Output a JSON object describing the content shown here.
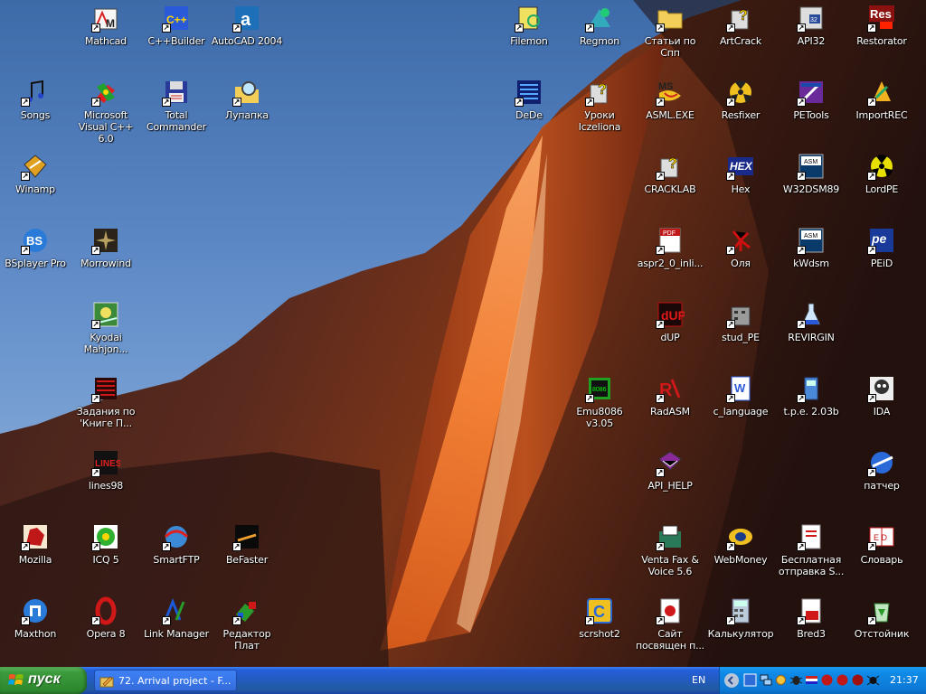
{
  "desktop": {
    "icons": [
      {
        "label": "Mathcad",
        "icon": "mathcad-icon"
      },
      {
        "label": "C++Builder",
        "icon": "cppbuilder-icon"
      },
      {
        "label": "AutoCAD 2004",
        "icon": "autocad-icon"
      },
      {
        "label": "Filemon",
        "icon": "filemon-icon"
      },
      {
        "label": "Regmon",
        "icon": "regmon-icon"
      },
      {
        "label": "Статьи по Спп",
        "icon": "folder-icon"
      },
      {
        "label": "ArtCrack",
        "icon": "help-icon"
      },
      {
        "label": "API32",
        "icon": "api32-icon"
      },
      {
        "label": "Restorator",
        "icon": "restorator-icon"
      },
      {
        "label": "Songs",
        "icon": "music-note-icon"
      },
      {
        "label": "Microsoft Visual C++ 6.0",
        "icon": "msvc-icon"
      },
      {
        "label": "Total Commander",
        "icon": "floppy-icon"
      },
      {
        "label": "Лупапка",
        "icon": "magnifier-folder-icon"
      },
      {
        "label": "DeDe",
        "icon": "dede-icon"
      },
      {
        "label": "Уроки Iczeliona",
        "icon": "help-icon"
      },
      {
        "label": "ASML.EXE",
        "icon": "msdos-icon"
      },
      {
        "label": "Resfixer",
        "icon": "radiation-yellow-icon"
      },
      {
        "label": "PETools",
        "icon": "petools-icon"
      },
      {
        "label": "ImportREC",
        "icon": "importrec-icon"
      },
      {
        "label": "Winamp",
        "icon": "winamp-icon"
      },
      {
        "label": "CRACKLAB",
        "icon": "help-icon"
      },
      {
        "label": "Hex",
        "icon": "hex-icon"
      },
      {
        "label": "W32DSM89",
        "icon": "asm-window-icon"
      },
      {
        "label": "LordPE",
        "icon": "radiation-icon"
      },
      {
        "label": "BSplayer Pro",
        "icon": "bsplayer-icon"
      },
      {
        "label": "Morrowind",
        "icon": "morrowind-icon"
      },
      {
        "label": "aspr2_0_inli...",
        "icon": "pdf-icon"
      },
      {
        "label": "Оля",
        "icon": "bug-icon"
      },
      {
        "label": "kWdsm",
        "icon": "asm-window-icon"
      },
      {
        "label": "PEiD",
        "icon": "peid-icon"
      },
      {
        "label": "Kyodai Mahjon...",
        "icon": "kyodai-icon"
      },
      {
        "label": "dUP",
        "icon": "dup-icon"
      },
      {
        "label": "stud_PE",
        "icon": "studpe-icon"
      },
      {
        "label": "REVIRGIN",
        "icon": "flask-icon"
      },
      {
        "label": "Задания по 'Книге П...",
        "icon": "lines-document-icon"
      },
      {
        "label": "Emu8086 v3.05",
        "icon": "chip-icon"
      },
      {
        "label": "RadASM",
        "icon": "radasm-icon"
      },
      {
        "label": "c_language",
        "icon": "word-document-icon"
      },
      {
        "label": "t.p.e. 2.03b",
        "icon": "tpe-icon"
      },
      {
        "label": "IDA",
        "icon": "ida-icon"
      },
      {
        "label": "lines98",
        "icon": "lines98-icon"
      },
      {
        "label": "API_HELP",
        "icon": "book-icon"
      },
      {
        "label": "патчер",
        "icon": "patcher-icon"
      },
      {
        "label": "Mozilla",
        "icon": "mozilla-icon"
      },
      {
        "label": "ICQ 5",
        "icon": "icq-icon"
      },
      {
        "label": "SmartFTP",
        "icon": "smartftp-icon"
      },
      {
        "label": "BeFaster",
        "icon": "befaster-icon"
      },
      {
        "label": "Venta Fax & Voice 5.6",
        "icon": "fax-icon"
      },
      {
        "label": "WebMoney",
        "icon": "webmoney-icon"
      },
      {
        "label": "Бесплатная отправка S...",
        "icon": "sms-icon"
      },
      {
        "label": "Словарь",
        "icon": "dictionary-icon"
      },
      {
        "label": "Maxthon",
        "icon": "maxthon-icon"
      },
      {
        "label": "Opera 8",
        "icon": "opera-icon"
      },
      {
        "label": "Link Manager",
        "icon": "link-manager-icon"
      },
      {
        "label": "Редактор Плат",
        "icon": "circuit-editor-icon"
      },
      {
        "label": "scrshot2",
        "icon": "scrshot-icon"
      },
      {
        "label": "Сайт посвящен п...",
        "icon": "html-page-icon"
      },
      {
        "label": "Калькулятор",
        "icon": "calculator-icon"
      },
      {
        "label": "Bred3",
        "icon": "bred-icon"
      },
      {
        "label": "Отстойник",
        "icon": "recycle-bin-icon"
      }
    ]
  },
  "taskbar": {
    "start_label": "пуск",
    "task_label": "72. Arrival project - F...",
    "language": "EN",
    "clock": "21:37"
  },
  "colors": {
    "start_green": "#3c9a3c",
    "taskbar_blue": "#245edb",
    "tray_blue": "#0f8be8"
  }
}
